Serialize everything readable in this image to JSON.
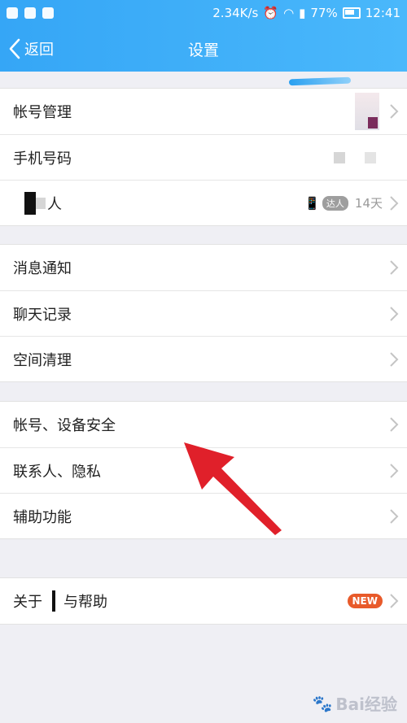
{
  "status_bar": {
    "speed": "2.34K/s",
    "battery": "77%",
    "time": "12:41"
  },
  "nav": {
    "back_label": "返回",
    "title": "设置"
  },
  "groups": [
    {
      "items": [
        {
          "label": "帐号管理"
        },
        {
          "label": "手机号码"
        },
        {
          "label": "人",
          "badge": "达人",
          "meta": "14天"
        }
      ]
    },
    {
      "items": [
        {
          "label": "消息通知"
        },
        {
          "label": "聊天记录"
        },
        {
          "label": "空间清理"
        }
      ]
    },
    {
      "items": [
        {
          "label": "帐号、设备安全"
        },
        {
          "label": "联系人、隐私"
        },
        {
          "label": "辅助功能"
        }
      ]
    },
    {
      "items": [
        {
          "label_prefix": "关于",
          "label_suffix": "与帮助",
          "badge": "NEW"
        }
      ]
    }
  ],
  "watermark": {
    "text": "Bai经验"
  },
  "colors": {
    "header": "#3aaaf8",
    "new_badge": "#e85a2a",
    "arrow": "#e0202a"
  }
}
